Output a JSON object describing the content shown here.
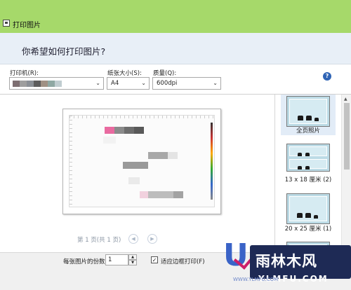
{
  "window": {
    "title": "打印图片"
  },
  "header": {
    "question": "你希望如何打印图片?"
  },
  "options": {
    "printer_label": "打印机(R):",
    "paper_size_label": "纸张大小(S):",
    "paper_size_value": "A4",
    "quality_label": "质量(Q):",
    "quality_value": "600dpi",
    "printer_swatches": [
      "#7d6e71",
      "#9e9e9e",
      "#8a8f95",
      "#5c5c5c",
      "#a09184",
      "#8fa8a3",
      "#c0cdd0"
    ]
  },
  "preview": {
    "page_info": "第 1 页(共 1 页)",
    "blocks": [
      {
        "color": "#e96aa0"
      },
      {
        "color": "#8b8b8b"
      },
      {
        "color": "#6d6d6d"
      },
      {
        "color": "#595959"
      },
      {
        "color": "#a8a8a8"
      },
      {
        "color": "#9a9a9a"
      },
      {
        "color": "#e4e4e4"
      },
      {
        "color": "#f1d1de"
      },
      {
        "color": "#bdbdbd"
      },
      {
        "color": "#a3a3a3"
      },
      {
        "color": "#eaeaea"
      },
      {
        "color": "#f2f2f2"
      }
    ]
  },
  "layouts": {
    "items": [
      {
        "label": "全页照片"
      },
      {
        "label": "13 x 18 厘米 (2)"
      },
      {
        "label": "20 x 25 厘米 (1)"
      },
      {
        "label": ""
      }
    ]
  },
  "footer": {
    "copies_label": "每张图片的份数(C):",
    "copies_value": "1",
    "fit_label": "适应边框打印(F)",
    "fit_checked": "✓"
  },
  "watermark": {
    "brand": "雨林木风",
    "url": "YLMFU.COM",
    "small": "WWW.YLMFU.COM"
  }
}
